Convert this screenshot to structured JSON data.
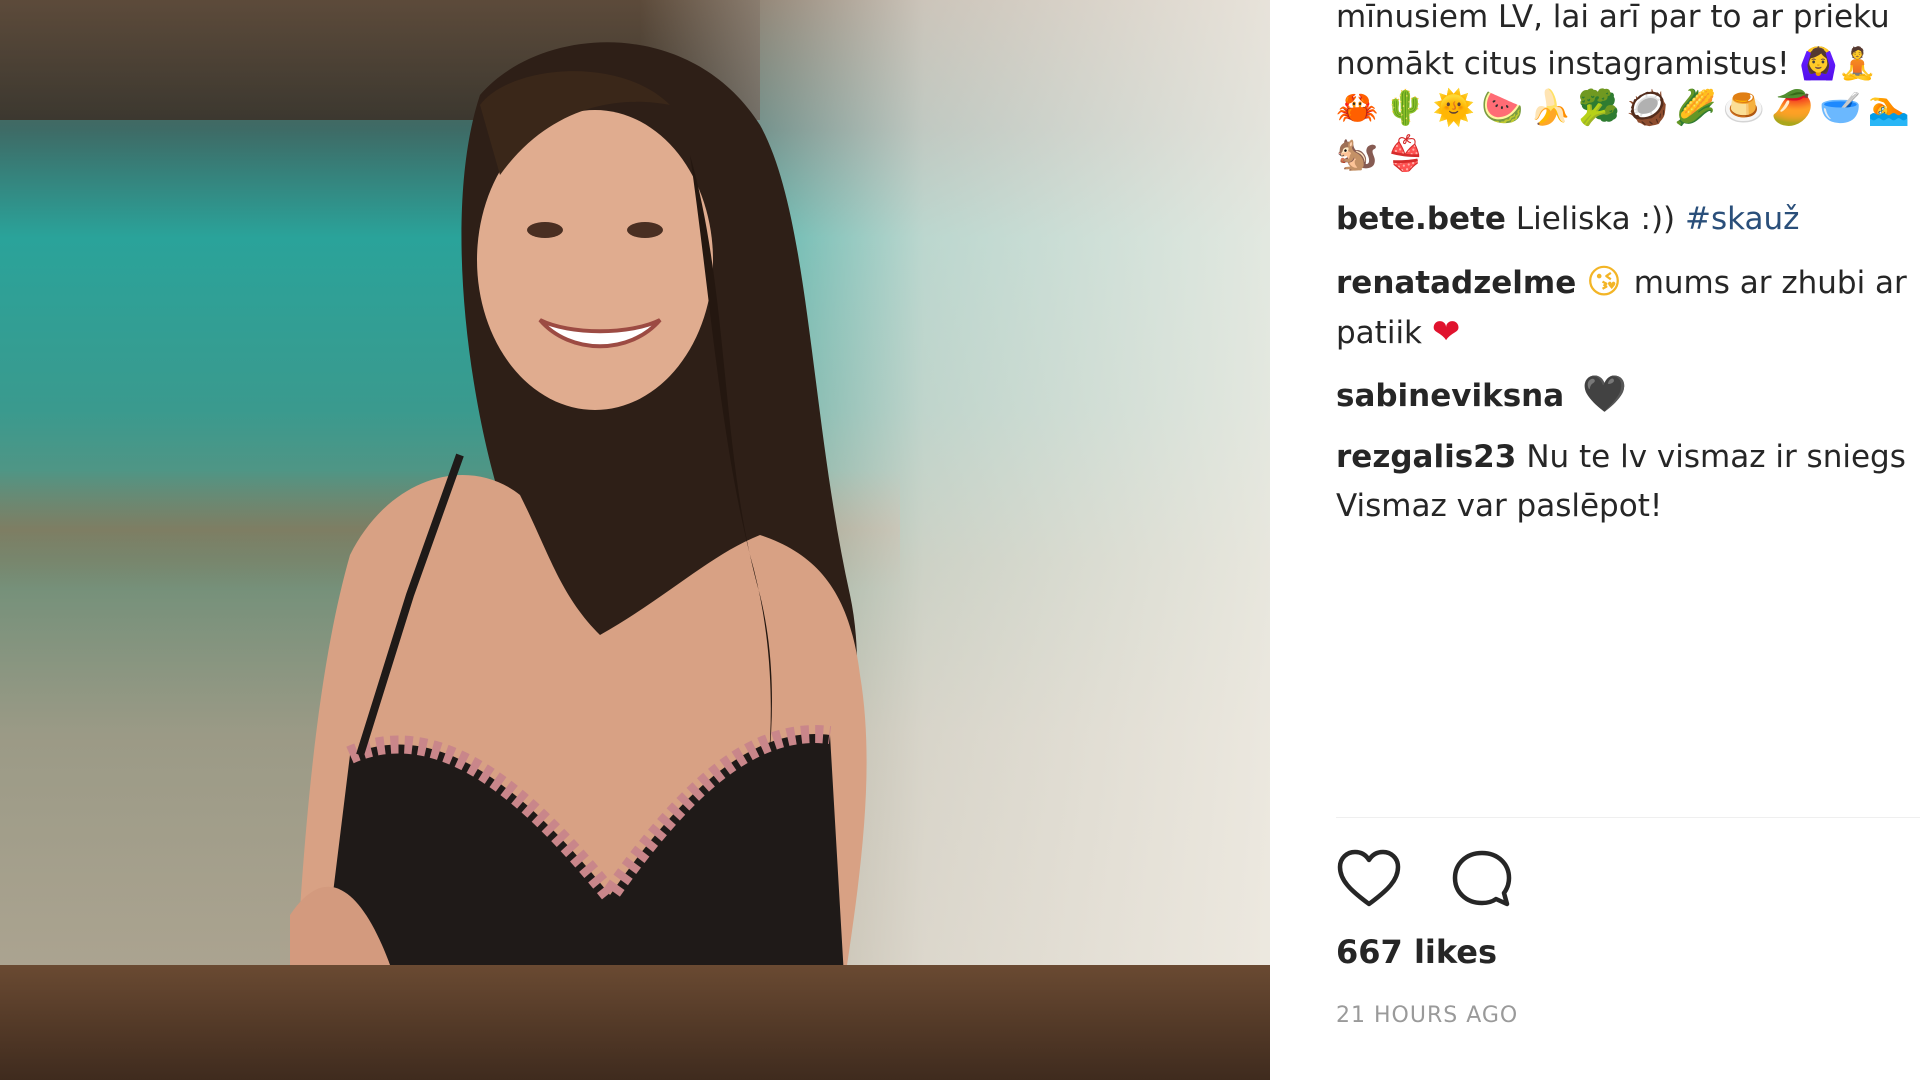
{
  "post": {
    "caption_line1": "mīnusiem LV, lai arī par to ar prieku",
    "caption_line2": "nomākt citus instagramistus! 🙆‍♀️🧘",
    "emoji_line1": "🦀🌵🌞🍉🍌🥦🥥🌽🍮🥭🥣🏊",
    "emoji_line2": "🐿️👙"
  },
  "comments": [
    {
      "user": "bete.bete",
      "text": "Lieliska :))",
      "hashtag": "#skauž"
    },
    {
      "user": "renatadzelme",
      "emoji": "😘",
      "text": "mums ar zhubi ar",
      "text2": "patiik",
      "heart": "❤"
    },
    {
      "user": "sabineviksna",
      "heart": "🖤"
    },
    {
      "user": "rezgalis23",
      "text": "Nu te lv vismaz ir sniegs",
      "text2": "Vismaz var paslēpot!"
    }
  ],
  "actions": {
    "like_icon": "heart-outline-icon",
    "comment_icon": "speech-bubble-icon"
  },
  "likes_text": "667 likes",
  "timestamp": "21 HOURS AGO",
  "colors": {
    "text": "#262626",
    "hashtag": "#2a4f7a",
    "timestamp": "#9a9a9a",
    "heart_red": "#e0132e"
  }
}
